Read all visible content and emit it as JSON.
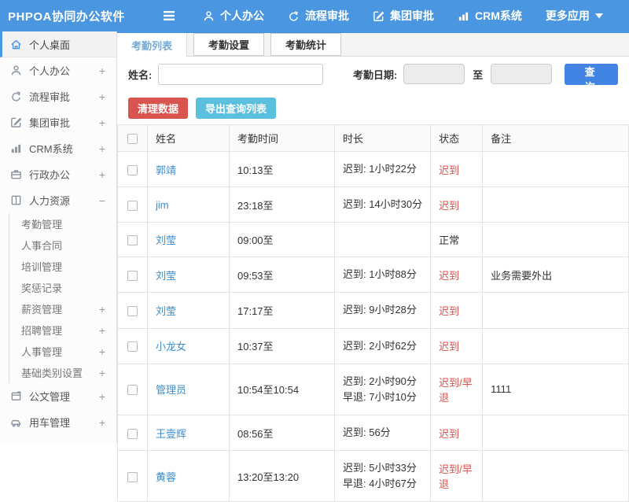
{
  "theme": {
    "topbar_blue": "#4a96e0",
    "link_blue": "#3e8ed0",
    "active_tab_blue": "#76abd9",
    "danger_red": "#d9534f",
    "info_cyan": "#5bc0de",
    "search_blue": "#4184e4"
  },
  "topbar": {
    "brand": "PHPOA协同办公软件",
    "nav": [
      {
        "label": "个人办公",
        "icon": "user-icon"
      },
      {
        "label": "流程审批",
        "icon": "workflow-icon"
      },
      {
        "label": "集团审批",
        "icon": "edit-icon"
      },
      {
        "label": "CRM系统",
        "icon": "chart-icon"
      },
      {
        "label": "更多应用",
        "icon": "caret-down-icon"
      }
    ]
  },
  "sidebar": {
    "items": [
      {
        "label": "个人桌面",
        "icon": "home-icon",
        "active": true,
        "expandable": false
      },
      {
        "label": "个人办公",
        "icon": "user-icon",
        "expandable": true,
        "expanded": false
      },
      {
        "label": "流程审批",
        "icon": "workflow-icon",
        "expandable": true,
        "expanded": false
      },
      {
        "label": "集团审批",
        "icon": "edit-icon",
        "expandable": true,
        "expanded": false
      },
      {
        "label": "CRM系统",
        "icon": "chart-icon",
        "expandable": true,
        "expanded": false
      },
      {
        "label": "行政办公",
        "icon": "briefcase-icon",
        "expandable": true,
        "expanded": false
      },
      {
        "label": "人力资源",
        "icon": "book-icon",
        "expandable": true,
        "expanded": true,
        "children": [
          {
            "label": "考勤管理",
            "expandable": false
          },
          {
            "label": "人事合同",
            "expandable": false
          },
          {
            "label": "培训管理",
            "expandable": false
          },
          {
            "label": "奖惩记录",
            "expandable": false
          },
          {
            "label": "薪资管理",
            "expandable": true
          },
          {
            "label": "招聘管理",
            "expandable": true
          },
          {
            "label": "人事管理",
            "expandable": true
          },
          {
            "label": "基础类别设置",
            "expandable": true
          }
        ]
      },
      {
        "label": "公文管理",
        "icon": "document-icon",
        "expandable": true,
        "expanded": false
      },
      {
        "label": "用车管理",
        "icon": "car-icon",
        "expandable": true,
        "expanded": false
      }
    ],
    "plus_glyph": "+",
    "minus_glyph": "−"
  },
  "tabs": [
    {
      "label": "考勤列表",
      "active": true
    },
    {
      "label": "考勤设置",
      "active": false
    },
    {
      "label": "考勤统计",
      "active": false
    }
  ],
  "filters": {
    "name_label": "姓名:",
    "name_value": "",
    "date_label": "考勤日期:",
    "date_start_value": "",
    "to_label": "至",
    "date_end_value": "",
    "search_button": "查 询"
  },
  "actions": {
    "clean": "清理数据",
    "export": "导出查询列表"
  },
  "table": {
    "headers": [
      "姓名",
      "考勤时间",
      "时长",
      "状态",
      "备注"
    ],
    "rows": [
      {
        "name": "郭靖",
        "time": "10:13至",
        "duration": [
          "迟到: 1小时22分"
        ],
        "status": "迟到",
        "status_type": "late",
        "note": ""
      },
      {
        "name": "jim",
        "time": "23:18至",
        "duration": [
          "迟到: 14小时30分"
        ],
        "status": "迟到",
        "status_type": "late",
        "note": ""
      },
      {
        "name": "刘莹",
        "time": "09:00至",
        "duration": [],
        "status": "正常",
        "status_type": "normal",
        "note": ""
      },
      {
        "name": "刘莹",
        "time": "09:53至",
        "duration": [
          "迟到: 1小时88分"
        ],
        "status": "迟到",
        "status_type": "late",
        "note": "业务需要外出"
      },
      {
        "name": "刘莹",
        "time": "17:17至",
        "duration": [
          "迟到: 9小时28分"
        ],
        "status": "迟到",
        "status_type": "late",
        "note": ""
      },
      {
        "name": "小龙女",
        "time": "10:37至",
        "duration": [
          "迟到: 2小时62分"
        ],
        "status": "迟到",
        "status_type": "late",
        "note": ""
      },
      {
        "name": "管理员",
        "time": "10:54至10:54",
        "duration": [
          "迟到: 2小时90分",
          "早退: 7小时10分"
        ],
        "status": "迟到/早退",
        "status_type": "late",
        "note": "1111"
      },
      {
        "name": "王壹辉",
        "time": "08:56至",
        "duration": [
          "迟到: 56分"
        ],
        "status": "迟到",
        "status_type": "late",
        "note": ""
      },
      {
        "name": "黄蓉",
        "time": "13:20至13:20",
        "duration": [
          "迟到: 5小时33分",
          "早退: 4小时67分"
        ],
        "status": "迟到/早退",
        "status_type": "late",
        "note": ""
      }
    ]
  }
}
